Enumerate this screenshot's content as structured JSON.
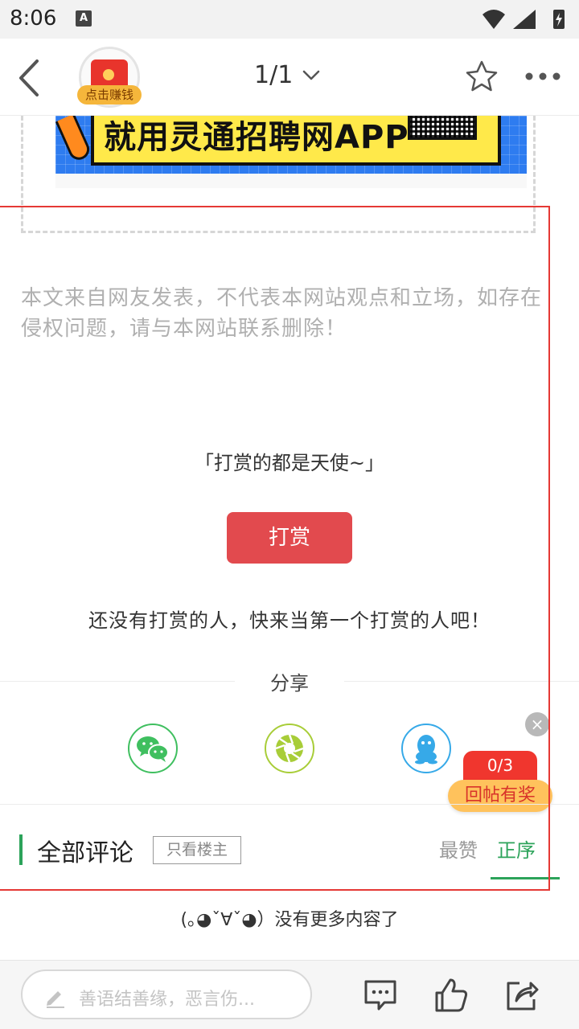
{
  "status_bar": {
    "time": "8:06",
    "notification_glyph": "A"
  },
  "header": {
    "earn_label": "点击赚钱",
    "page_indicator": "1/1",
    "icons": [
      "back-icon",
      "red-envelope-icon",
      "chevron-down-icon",
      "star-icon",
      "more-icon"
    ]
  },
  "banner": {
    "text": "就用灵通招聘网APP"
  },
  "article": {
    "disclaimer": "本文来自网友发表，不代表本网站观点和立场，如存在侵权问题，请与本网站联系删除！"
  },
  "reward": {
    "slogan": "「打赏的都是天使~」",
    "button_label": "打赏",
    "empty_text": "还没有打赏的人，快来当第一个打赏的人吧！"
  },
  "share": {
    "title": "分享",
    "targets": [
      "wechat-icon",
      "moments-icon",
      "qq-icon"
    ]
  },
  "floating_reward": {
    "close": "×",
    "count": "0/3",
    "label": "回帖有奖"
  },
  "comments": {
    "title": "全部评论",
    "owner_only": "只看楼主",
    "sort_hot": "最赞",
    "sort_order": "正序"
  },
  "footer": {
    "no_more": "(｡◕ˇ∀ˇ◕）没有更多内容了"
  },
  "bottom_bar": {
    "placeholder": "善语结善缘，恶言伤...",
    "icons": [
      "comment-icon",
      "like-icon",
      "share-icon"
    ]
  },
  "colors": {
    "accent_green": "#2ca35a",
    "reward_red": "#e24a4e",
    "highlight_red": "#e53935"
  }
}
